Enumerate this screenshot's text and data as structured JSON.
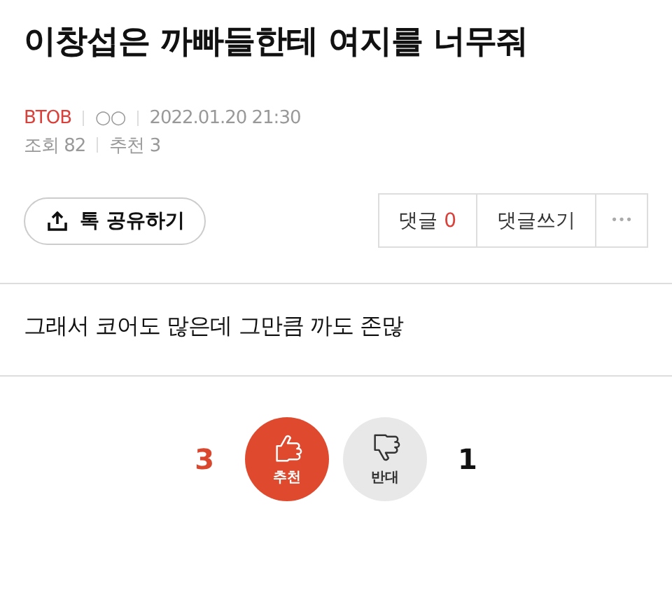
{
  "title": "이창섭은 까빠들한테 여지를 너무줘",
  "meta": {
    "board": "BTOB",
    "author": "○○",
    "datetime": "2022.01.20 21:30",
    "views": "조회 82",
    "recommends": "추천 3"
  },
  "share_button": "톡 공유하기",
  "comment_buttons": {
    "comments_label": "댓글",
    "comments_count": "0",
    "write": "댓글쓰기",
    "more": "•••"
  },
  "body": "그래서 코어도 많은데 그만큼 까도 존많",
  "votes": [
    {
      "kind": "up",
      "count": "3",
      "label": "추천"
    },
    {
      "kind": "down",
      "count": "1",
      "label": "반대"
    }
  ]
}
